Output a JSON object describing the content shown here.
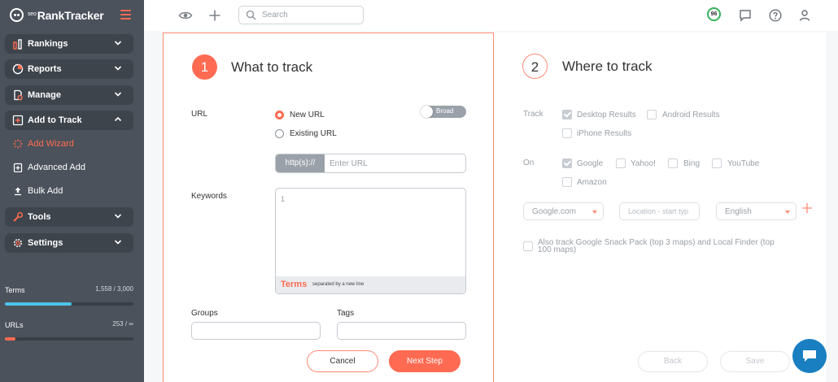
{
  "app": {
    "logo_prefix": "seo",
    "logo_name": "RankTracker"
  },
  "sidebar": {
    "items": [
      {
        "label": "Rankings",
        "icon": "rankings-icon"
      },
      {
        "label": "Reports",
        "icon": "pie-chart-icon"
      },
      {
        "label": "Manage",
        "icon": "manage-icon"
      },
      {
        "label": "Add to Track",
        "icon": "add-square-icon",
        "expanded": true
      },
      {
        "label": "Tools",
        "icon": "tools-icon"
      },
      {
        "label": "Settings",
        "icon": "gear-icon"
      }
    ],
    "subitems": [
      {
        "label": "Add Wizard",
        "icon": "wizard-icon",
        "active": true
      },
      {
        "label": "Advanced Add",
        "icon": "advanced-add-icon"
      },
      {
        "label": "Bulk Add",
        "icon": "upload-icon"
      }
    ],
    "stats": {
      "terms": {
        "label": "Terms",
        "value": "1,558 / 3,000",
        "fraction": 0.52,
        "color": "#4fc3e8"
      },
      "urls": {
        "label": "URLs",
        "value": "253 / ∞",
        "fraction": 0.08,
        "color": "#ff6b52"
      }
    }
  },
  "topbar": {
    "search_placeholder": "Search",
    "score": "96"
  },
  "step1": {
    "number": "1",
    "title": "What to track",
    "url_label": "URL",
    "new_url": "New URL",
    "existing_url": "Existing URL",
    "broad_label": "Broad",
    "url_prefix": "http(s)://",
    "url_placeholder": "Enter URL",
    "keywords_label": "Keywords",
    "kw_line": "1",
    "kw_terms": "Terms",
    "kw_hint": "separated by a new line",
    "groups_label": "Groups",
    "tags_label": "Tags",
    "cancel": "Cancel",
    "next": "Next Step"
  },
  "step2": {
    "number": "2",
    "title": "Where to track",
    "track_label": "Track",
    "desktop": "Desktop Results",
    "android": "Android Results",
    "iphone": "iPhone Results",
    "on_label": "On",
    "google": "Google",
    "yahoo": "Yahoo!",
    "bing": "Bing",
    "youtube": "YouTube",
    "amazon": "Amazon",
    "engine_select": "Google.com",
    "location_placeholder": "Location - start typ",
    "language_select": "English",
    "snack_pack": "Also track Google Snack Pack (top 3 maps) and Local Finder (top 100 maps)",
    "back": "Back",
    "save": "Save"
  },
  "colors": {
    "accent": "#ff6b52",
    "sidebar": "#4b525b",
    "score_ring": "#35b35c",
    "chat": "#1a7fc1"
  }
}
